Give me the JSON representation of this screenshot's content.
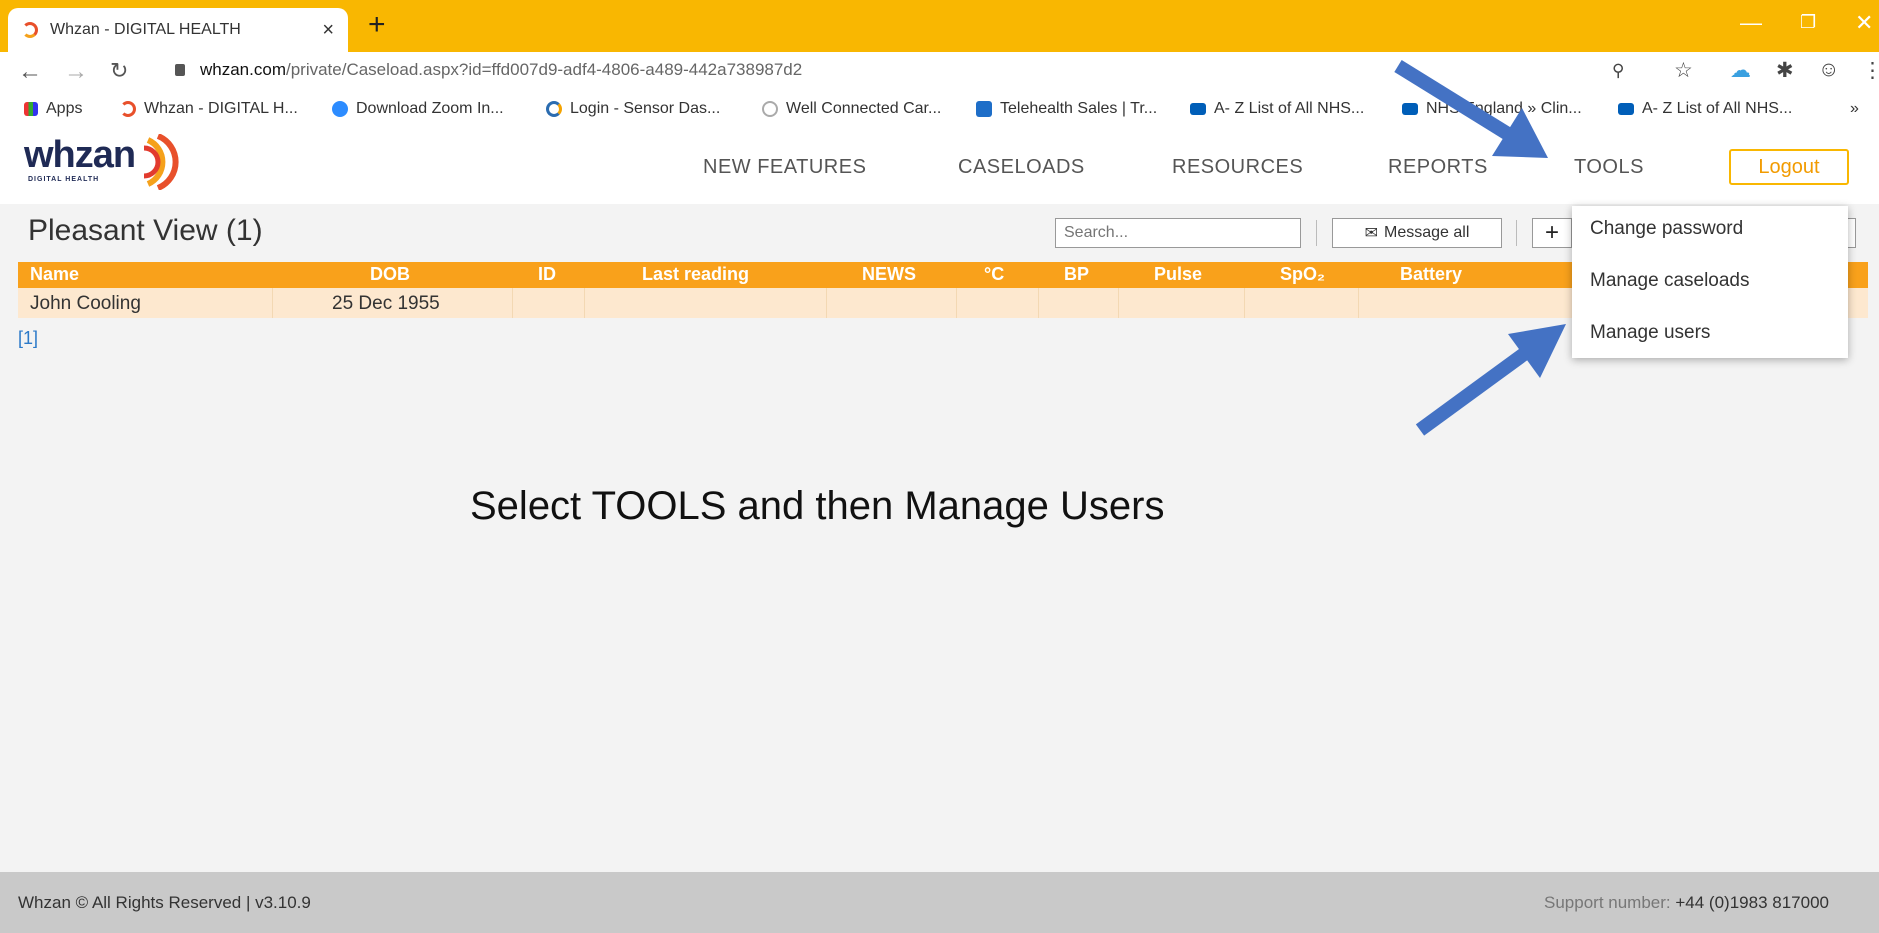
{
  "browser": {
    "tab_title": "Whzan - DIGITAL HEALTH",
    "tab_close": "×",
    "new_tab": "+",
    "url_host": "whzan.com",
    "url_path": "/private/Caseload.aspx?id=ffd007d9-adf4-4806-a489-442a738987d2",
    "bookmarks": [
      {
        "label": "Apps",
        "icon": "apps-grid-icon"
      },
      {
        "label": "Whzan - DIGITAL H...",
        "icon": "whzan-icon"
      },
      {
        "label": "Download Zoom In...",
        "icon": "zoom-icon"
      },
      {
        "label": "Login - Sensor Das...",
        "icon": "sensor-icon"
      },
      {
        "label": "Well Connected Car...",
        "icon": "wellconnected-icon"
      },
      {
        "label": "Telehealth Sales | Tr...",
        "icon": "trello-icon"
      },
      {
        "label": "A- Z List of All NHS...",
        "icon": "nhs-icon"
      },
      {
        "label": "NHS England » Clin...",
        "icon": "nhs-icon"
      },
      {
        "label": "A- Z List of All NHS...",
        "icon": "nhs-icon"
      }
    ],
    "more_bookmarks": "»"
  },
  "site": {
    "logo_text": "whzan",
    "logo_sub": "DIGITAL HEALTH",
    "nav": [
      "NEW FEATURES",
      "CASELOADS",
      "RESOURCES",
      "REPORTS",
      "TOOLS"
    ],
    "logout": "Logout"
  },
  "page": {
    "title": "Pleasant View (1)",
    "search_placeholder": "Search...",
    "message_all": "Message all",
    "add_label": "+"
  },
  "table": {
    "columns": [
      "Name",
      "DOB",
      "ID",
      "Last reading",
      "NEWS",
      "°C",
      "BP",
      "Pulse",
      "SpO₂",
      "Battery"
    ],
    "rows": [
      {
        "name": "John Cooling",
        "dob": "25 Dec 1955"
      }
    ],
    "pager": "[1]"
  },
  "dropdown": {
    "items": [
      "Change password",
      "Manage caseloads",
      "Manage users"
    ]
  },
  "annotation": {
    "instruction": "Select TOOLS and then Manage Users",
    "arrow_color": "#4472c4"
  },
  "footer": {
    "left": "Whzan © All Rights Reserved | v3.10.9",
    "support_label": "Support number:",
    "support_number": "+44 (0)1983 817000"
  },
  "colors": {
    "accent": "#f9b701",
    "table_header": "#f9a11b",
    "row_bg": "#fde8cf"
  }
}
